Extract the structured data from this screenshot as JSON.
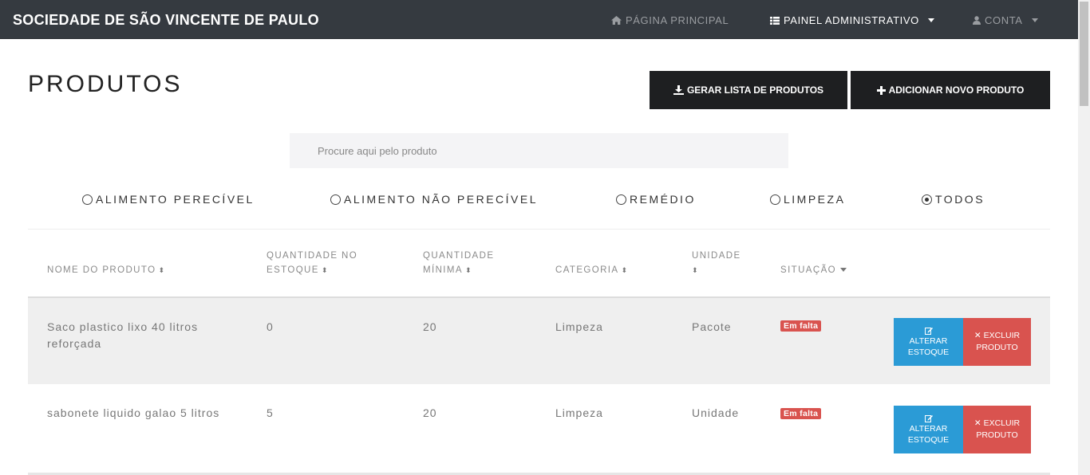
{
  "navbar": {
    "brand": "SOCIEDADE DE SÃO VINCENTE DE PAULO",
    "home": {
      "icon": "home-icon",
      "label": "PÁGINA PRINCIPAL"
    },
    "admin": {
      "icon": "table-icon",
      "label": "PAINEL ADMINISTRATIVO"
    },
    "account": {
      "icon": "user-icon",
      "label": "CONTA"
    }
  },
  "page": {
    "title": "PRODUTOS",
    "generate_button": {
      "icon": "download-icon",
      "label": "GERAR LISTA DE PRODUTOS"
    },
    "add_button": {
      "icon": "plus-icon",
      "label": "ADICIONAR NOVO PRODUTO"
    }
  },
  "search": {
    "placeholder": "Procure aqui pelo produto",
    "value": ""
  },
  "filters": [
    {
      "label": "ALIMENTO PERECÍVEL",
      "checked": false
    },
    {
      "label": "ALIMENTO NÃO PERECÍVEL",
      "checked": false
    },
    {
      "label": "REMÉDIO",
      "checked": false
    },
    {
      "label": "LIMPEZA",
      "checked": false
    },
    {
      "label": "TODOS",
      "checked": true
    }
  ],
  "table": {
    "headers": {
      "name": "NOME DO PRODUTO",
      "qty_line1": "QUANTIDADE NO",
      "qty_line2": "ESTOQUE",
      "min_line1": "QUANTIDADE",
      "min_line2": "MÍNIMA",
      "category": "CATEGORIA",
      "unit": "UNIDADE",
      "status": "SITUAÇÃO"
    },
    "rows": [
      {
        "name_line1": "Saco plastico lixo 40 litros",
        "name_line2": "reforçada",
        "quantity": "0",
        "minimum": "20",
        "category": "Limpeza",
        "unit": "Pacote",
        "status": "Em falta",
        "alter_line1": "ALTERAR",
        "alter_line2": "ESTOQUE",
        "delete_line1": "EXCLUIR",
        "delete_line2": "PRODUTO"
      },
      {
        "name_line1": "sabonete liquido galao 5 litros",
        "name_line2": "",
        "quantity": "5",
        "minimum": "20",
        "category": "Limpeza",
        "unit": "Unidade",
        "status": "Em falta",
        "alter_line1": "ALTERAR",
        "alter_line2": "ESTOQUE",
        "delete_line1": "EXCLUIR",
        "delete_line2": "PRODUTO"
      }
    ]
  },
  "colors": {
    "navbar": "#353a40",
    "primary_dark": "#1e1f21",
    "info": "#2b9bd6",
    "danger": "#d9534f"
  }
}
